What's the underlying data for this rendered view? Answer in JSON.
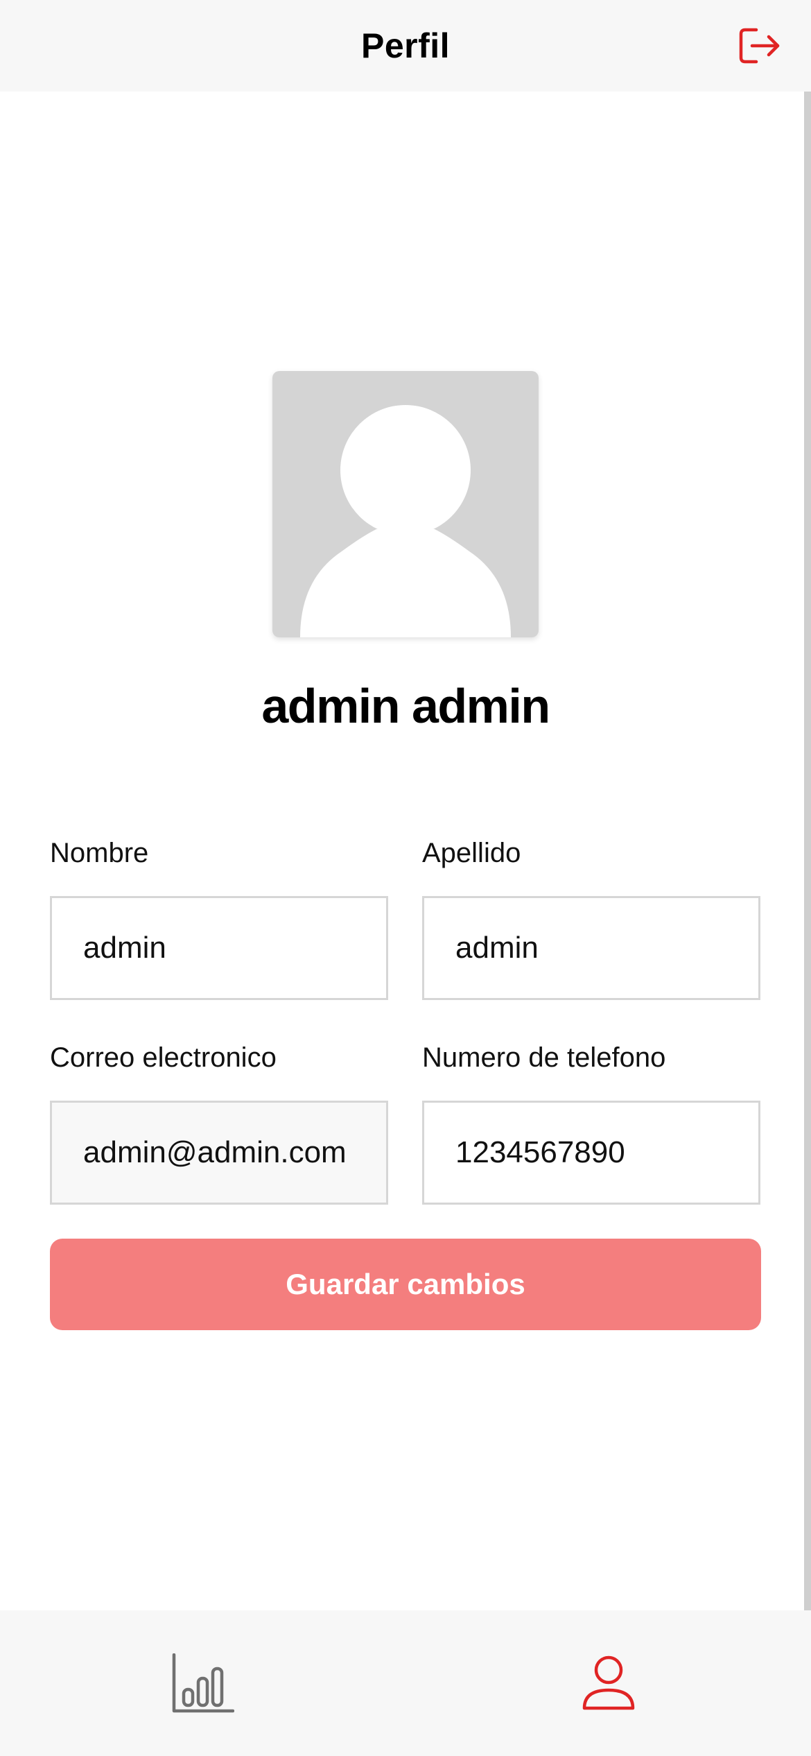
{
  "header": {
    "title": "Perfil",
    "logout_icon": "logout-icon"
  },
  "profile": {
    "avatar_icon": "user-placeholder-icon",
    "full_name": "admin admin"
  },
  "form": {
    "nombre": {
      "label": "Nombre",
      "value": "admin"
    },
    "apellido": {
      "label": "Apellido",
      "value": "admin"
    },
    "correo": {
      "label": "Correo electronico",
      "value": "admin@admin.com"
    },
    "telefono": {
      "label": "Numero de telefono",
      "value": "1234567890"
    },
    "save_label": "Guardar cambios"
  },
  "bottom_nav": {
    "items": [
      {
        "icon": "bar-chart-icon",
        "active": false
      },
      {
        "icon": "user-icon",
        "active": true
      }
    ]
  },
  "colors": {
    "accent": "#e02424",
    "button": "#f47e7e",
    "inactive_icon": "#707070"
  }
}
